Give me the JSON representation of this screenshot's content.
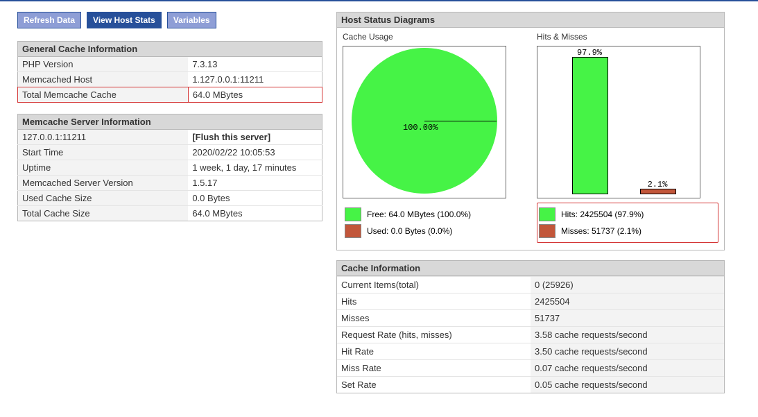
{
  "toolbar": {
    "refresh": "Refresh Data",
    "hoststats": "View Host Stats",
    "variables": "Variables"
  },
  "general": {
    "header": "General Cache Information",
    "rows": [
      {
        "label": "PHP Version",
        "value": "7.3.13"
      },
      {
        "label": "Memcached Host",
        "value": "1.127.0.0.1:11211"
      },
      {
        "label": "Total Memcache Cache",
        "value": "64.0 MBytes"
      }
    ]
  },
  "server": {
    "header": "Memcache Server Information",
    "host": "127.0.0.1:11211",
    "flush": "[Flush this server]",
    "rows": [
      {
        "label": "Start Time",
        "value": "2020/02/22 10:05:53"
      },
      {
        "label": "Uptime",
        "value": "1 week, 1 day, 17 minutes"
      },
      {
        "label": "Memcached Server Version",
        "value": "1.5.17"
      },
      {
        "label": "Used Cache Size",
        "value": "0.0 Bytes"
      },
      {
        "label": "Total Cache Size",
        "value": "64.0 MBytes"
      }
    ]
  },
  "diagrams": {
    "header": "Host Status Diagrams",
    "usage": {
      "title": "Cache Usage",
      "pie_label": "100.00%",
      "free": "Free: 64.0 MBytes (100.0%)",
      "used": "Used: 0.0 Bytes (0.0%)"
    },
    "hm": {
      "title": "Hits & Misses",
      "hits_pct": "97.9%",
      "miss_pct": "2.1%",
      "hits": "Hits: 2425504 (97.9%)",
      "misses": "Misses: 51737 (2.1%)"
    }
  },
  "cacheinfo": {
    "header": "Cache Information",
    "rows": [
      {
        "label": "Current Items(total)",
        "value": "0 (25926)"
      },
      {
        "label": "Hits",
        "value": "2425504"
      },
      {
        "label": "Misses",
        "value": "51737"
      },
      {
        "label": "Request Rate (hits, misses)",
        "value": "3.58 cache requests/second"
      },
      {
        "label": "Hit Rate",
        "value": "3.50 cache requests/second"
      },
      {
        "label": "Miss Rate",
        "value": "0.07 cache requests/second"
      },
      {
        "label": "Set Rate",
        "value": "0.05 cache requests/second"
      }
    ]
  },
  "chart_data": [
    {
      "type": "pie",
      "title": "Cache Usage",
      "series": [
        {
          "name": "Free",
          "value": 64.0,
          "unit": "MBytes",
          "pct": 100.0,
          "color": "#46f346"
        },
        {
          "name": "Used",
          "value": 0.0,
          "unit": "Bytes",
          "pct": 0.0,
          "color": "#c2563a"
        }
      ]
    },
    {
      "type": "bar",
      "title": "Hits & Misses",
      "categories": [
        "Hits",
        "Misses"
      ],
      "values": [
        2425504,
        51737
      ],
      "percents": [
        97.9,
        2.1
      ],
      "colors": [
        "#46f346",
        "#c2563a"
      ],
      "ylim": [
        0,
        100
      ]
    }
  ]
}
